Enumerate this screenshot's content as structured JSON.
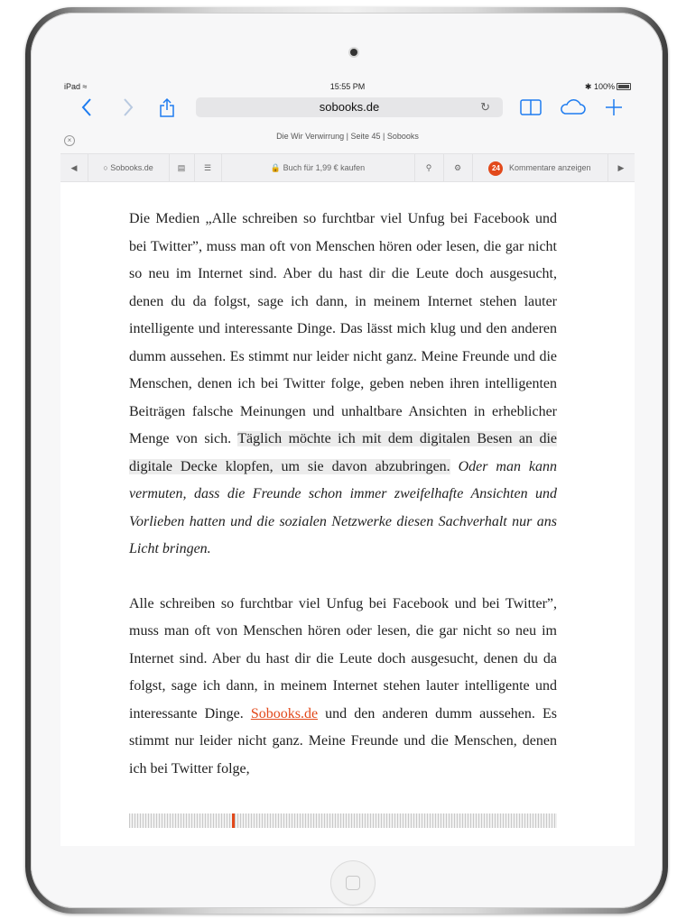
{
  "status_bar": {
    "device": "iPad",
    "time": "15:55 PM",
    "battery": "100%"
  },
  "nav_bar": {
    "url": "sobooks.de"
  },
  "page_title": "Die Wir Verwirrung | Seite 45 | Sobooks",
  "toolbar": {
    "site_label": "Sobooks.de",
    "buy_label": "Buch für 1,99 € kaufen",
    "comments_count": "24",
    "comments_label": "Kommentare anzeigen"
  },
  "article": {
    "p1_normal": "Die Medien „Alle schreiben so furchtbar viel Unfug bei Facebook und bei Twitter”, muss man oft von Menschen hören oder lesen, die gar nicht so neu im Internet sind. Aber du hast dir die Leute doch ausgesucht, denen du da folgst, sage ich dann, in meinem Internet stehen lauter intelligente und interessante Dinge. Das lässt mich klug und den anderen dumm aussehen.  Es stimmt nur leider nicht ganz. Meine Freunde und die Menschen, denen ich bei Twitter folge, geben neben ihren intelligenten Beiträgen falsche Meinungen und unhaltbare Ansichten in erheblicher Menge von sich.",
    "p1_highlight": "Täglich möchte ich mit dem digitalen Besen an die digitale Decke klopfen, um sie davon abzubringen.",
    "p1_italic": "Oder man kann vermuten, dass die Freunde schon immer zweifelhafte Ansichten und Vorlieben hatten und die sozialen Netzwerke diesen Sachverhalt nur ans Licht bringen.",
    "p2_before": "Alle schreiben so furchtbar viel Unfug bei Facebook und bei Twitter”, muss man oft von Menschen hören oder lesen, die gar nicht so neu im Internet sind. Aber du hast dir die Leute doch ausgesucht, denen du da folgst, sage ich dann, in meinem Internet stehen lauter intelligente und interessante Dinge.",
    "p2_link": "Sobooks.de",
    "p2_after": "und den anderen dumm aussehen.  Es stimmt nur leider nicht ganz. Meine Freunde und die Menschen, denen ich bei Twitter folge,"
  },
  "reading_progress": 0.24,
  "colors": {
    "accent": "#e2491b",
    "ios_blue": "#1e7cf0"
  }
}
